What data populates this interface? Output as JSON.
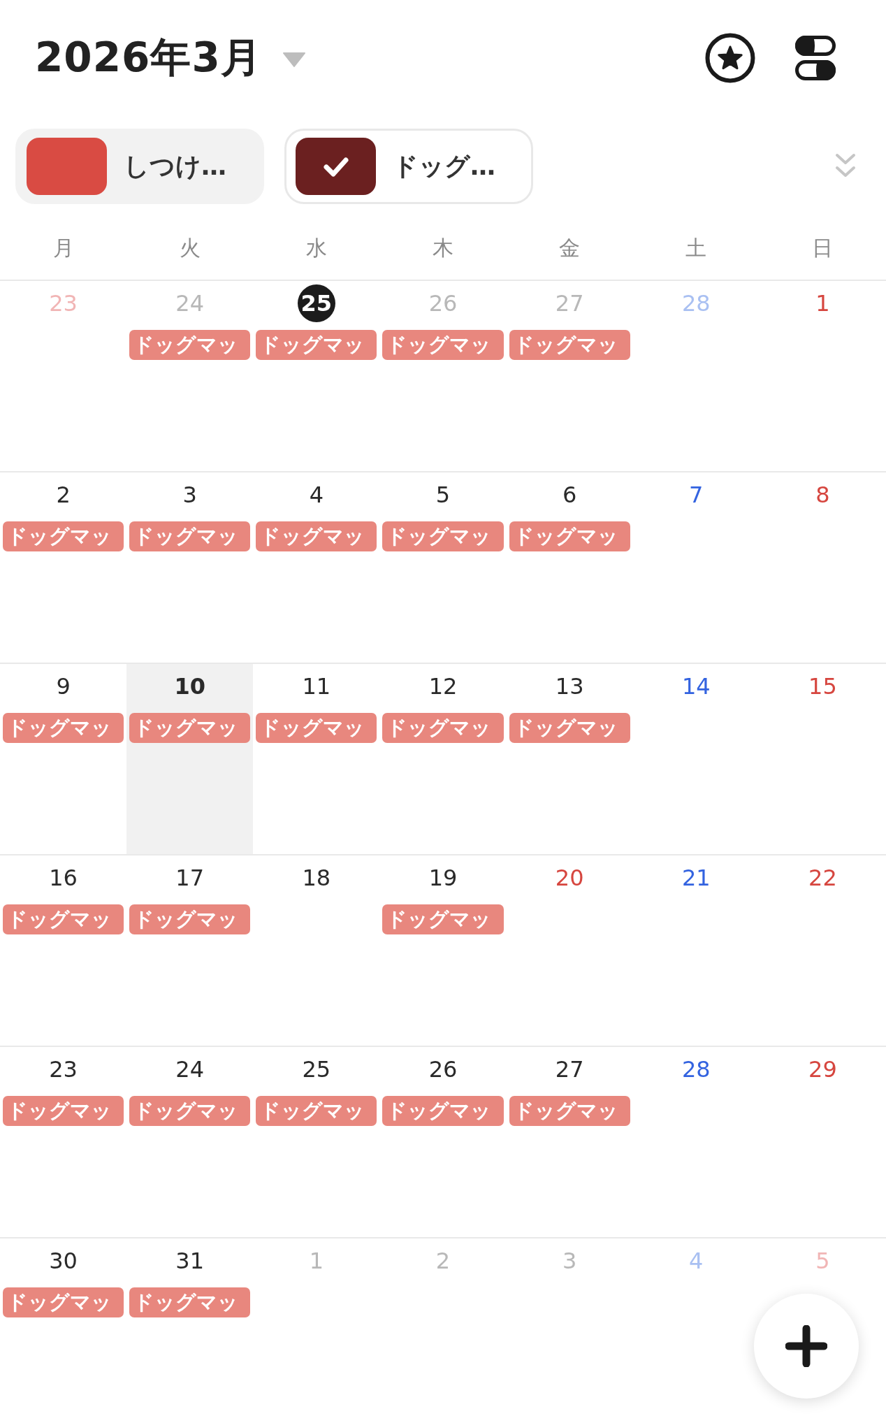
{
  "header": {
    "title": "2026年3月"
  },
  "filters": [
    {
      "label": "しつけ…",
      "color": "#d94b43",
      "checked": false
    },
    {
      "label": "ドッグ…",
      "color": "#6b2020",
      "checked": true
    }
  ],
  "weekdays": [
    "月",
    "火",
    "水",
    "木",
    "金",
    "土",
    "日"
  ],
  "weeks": [
    {
      "days": [
        {
          "day": "23",
          "kind": "holiday",
          "outside": true,
          "today": false,
          "selected": false
        },
        {
          "day": "24",
          "kind": "weekday",
          "outside": true,
          "today": false,
          "selected": false,
          "events": [
            {
              "title": "ドッグマッ"
            }
          ]
        },
        {
          "day": "25",
          "kind": "weekday",
          "outside": true,
          "today": true,
          "selected": false,
          "events": [
            {
              "title": "ドッグマッ"
            }
          ]
        },
        {
          "day": "26",
          "kind": "weekday",
          "outside": true,
          "today": false,
          "selected": false,
          "events": [
            {
              "title": "ドッグマッ"
            }
          ]
        },
        {
          "day": "27",
          "kind": "weekday",
          "outside": true,
          "today": false,
          "selected": false,
          "events": [
            {
              "title": "ドッグマッ"
            }
          ]
        },
        {
          "day": "28",
          "kind": "saturday",
          "outside": true,
          "today": false,
          "selected": false
        },
        {
          "day": "1",
          "kind": "holiday",
          "outside": false,
          "today": false,
          "selected": false
        }
      ]
    },
    {
      "days": [
        {
          "day": "2",
          "kind": "weekday",
          "outside": false,
          "today": false,
          "selected": false,
          "events": [
            {
              "title": "ドッグマッ"
            }
          ]
        },
        {
          "day": "3",
          "kind": "weekday",
          "outside": false,
          "today": false,
          "selected": false,
          "events": [
            {
              "title": "ドッグマッ"
            }
          ]
        },
        {
          "day": "4",
          "kind": "weekday",
          "outside": false,
          "today": false,
          "selected": false,
          "events": [
            {
              "title": "ドッグマッ"
            }
          ]
        },
        {
          "day": "5",
          "kind": "weekday",
          "outside": false,
          "today": false,
          "selected": false,
          "events": [
            {
              "title": "ドッグマッ"
            }
          ]
        },
        {
          "day": "6",
          "kind": "weekday",
          "outside": false,
          "today": false,
          "selected": false,
          "events": [
            {
              "title": "ドッグマッ"
            }
          ]
        },
        {
          "day": "7",
          "kind": "saturday",
          "outside": false,
          "today": false,
          "selected": false
        },
        {
          "day": "8",
          "kind": "holiday",
          "outside": false,
          "today": false,
          "selected": false
        }
      ]
    },
    {
      "days": [
        {
          "day": "9",
          "kind": "weekday",
          "outside": false,
          "today": false,
          "selected": false,
          "events": [
            {
              "title": "ドッグマッ"
            }
          ]
        },
        {
          "day": "10",
          "kind": "weekday",
          "outside": false,
          "today": false,
          "selected": true,
          "events": [
            {
              "title": "ドッグマッ"
            }
          ]
        },
        {
          "day": "11",
          "kind": "weekday",
          "outside": false,
          "today": false,
          "selected": false,
          "events": [
            {
              "title": "ドッグマッ"
            }
          ]
        },
        {
          "day": "12",
          "kind": "weekday",
          "outside": false,
          "today": false,
          "selected": false,
          "events": [
            {
              "title": "ドッグマッ"
            }
          ]
        },
        {
          "day": "13",
          "kind": "weekday",
          "outside": false,
          "today": false,
          "selected": false,
          "events": [
            {
              "title": "ドッグマッ"
            }
          ]
        },
        {
          "day": "14",
          "kind": "saturday",
          "outside": false,
          "today": false,
          "selected": false
        },
        {
          "day": "15",
          "kind": "holiday",
          "outside": false,
          "today": false,
          "selected": false
        }
      ]
    },
    {
      "days": [
        {
          "day": "16",
          "kind": "weekday",
          "outside": false,
          "today": false,
          "selected": false,
          "events": [
            {
              "title": "ドッグマッ"
            }
          ]
        },
        {
          "day": "17",
          "kind": "weekday",
          "outside": false,
          "today": false,
          "selected": false,
          "events": [
            {
              "title": "ドッグマッ"
            }
          ]
        },
        {
          "day": "18",
          "kind": "weekday",
          "outside": false,
          "today": false,
          "selected": false
        },
        {
          "day": "19",
          "kind": "weekday",
          "outside": false,
          "today": false,
          "selected": false,
          "events": [
            {
              "title": "ドッグマッ"
            }
          ]
        },
        {
          "day": "20",
          "kind": "holiday",
          "outside": false,
          "today": false,
          "selected": false
        },
        {
          "day": "21",
          "kind": "saturday",
          "outside": false,
          "today": false,
          "selected": false
        },
        {
          "day": "22",
          "kind": "holiday",
          "outside": false,
          "today": false,
          "selected": false
        }
      ]
    },
    {
      "days": [
        {
          "day": "23",
          "kind": "weekday",
          "outside": false,
          "today": false,
          "selected": false,
          "events": [
            {
              "title": "ドッグマッ"
            }
          ]
        },
        {
          "day": "24",
          "kind": "weekday",
          "outside": false,
          "today": false,
          "selected": false,
          "events": [
            {
              "title": "ドッグマッ"
            }
          ]
        },
        {
          "day": "25",
          "kind": "weekday",
          "outside": false,
          "today": false,
          "selected": false,
          "events": [
            {
              "title": "ドッグマッ"
            }
          ]
        },
        {
          "day": "26",
          "kind": "weekday",
          "outside": false,
          "today": false,
          "selected": false,
          "events": [
            {
              "title": "ドッグマッ"
            }
          ]
        },
        {
          "day": "27",
          "kind": "weekday",
          "outside": false,
          "today": false,
          "selected": false,
          "events": [
            {
              "title": "ドッグマッ"
            }
          ]
        },
        {
          "day": "28",
          "kind": "saturday",
          "outside": false,
          "today": false,
          "selected": false
        },
        {
          "day": "29",
          "kind": "holiday",
          "outside": false,
          "today": false,
          "selected": false
        }
      ]
    },
    {
      "days": [
        {
          "day": "30",
          "kind": "weekday",
          "outside": false,
          "today": false,
          "selected": false,
          "events": [
            {
              "title": "ドッグマッ"
            }
          ]
        },
        {
          "day": "31",
          "kind": "weekday",
          "outside": false,
          "today": false,
          "selected": false,
          "events": [
            {
              "title": "ドッグマッ"
            }
          ]
        },
        {
          "day": "1",
          "kind": "weekday",
          "outside": true,
          "today": false,
          "selected": false
        },
        {
          "day": "2",
          "kind": "weekday",
          "outside": true,
          "today": false,
          "selected": false
        },
        {
          "day": "3",
          "kind": "weekday",
          "outside": true,
          "today": false,
          "selected": false
        },
        {
          "day": "4",
          "kind": "saturday",
          "outside": true,
          "today": false,
          "selected": false
        },
        {
          "day": "5",
          "kind": "holiday",
          "outside": true,
          "today": false,
          "selected": false
        }
      ]
    }
  ]
}
